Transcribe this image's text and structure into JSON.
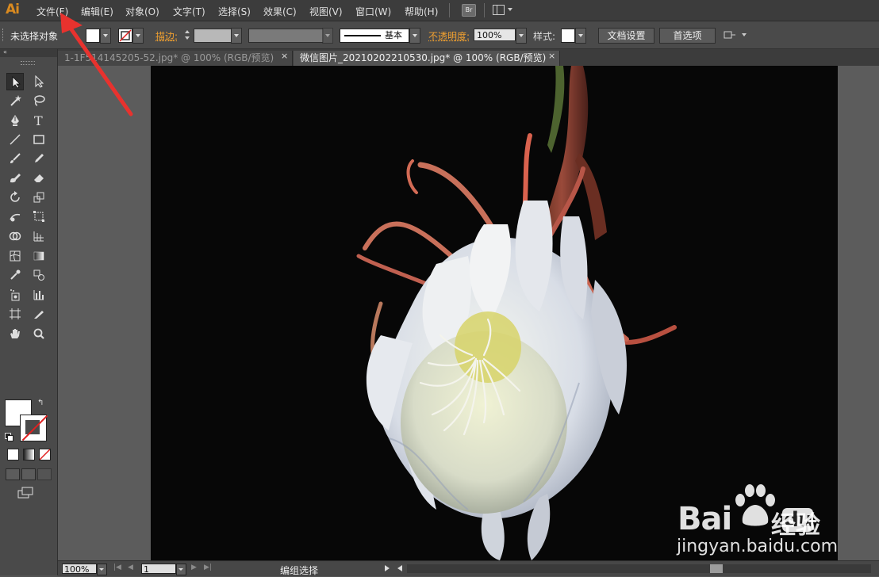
{
  "app": {
    "logo": "Ai"
  },
  "menu": {
    "items": [
      "文件(F)",
      "编辑(E)",
      "对象(O)",
      "文字(T)",
      "选择(S)",
      "效果(C)",
      "视图(V)",
      "窗口(W)",
      "帮助(H)"
    ],
    "bridge_label": "Br"
  },
  "control_bar": {
    "selection_status": "未选择对象",
    "stroke_label": "描边:",
    "brush_label": "基本",
    "opacity_label": "不透明度:",
    "opacity_value": "100%",
    "style_label": "样式:",
    "document_setup": "文档设置",
    "preferences": "首选项"
  },
  "tabs": [
    {
      "title": "1-1F514145205-52.jpg* @ 100% (RGB/预览)",
      "close": "×"
    },
    {
      "title": "微信图片_20210202210530.jpg* @ 100% (RGB/预览)",
      "close": "×"
    }
  ],
  "status_bar": {
    "zoom": "100%",
    "artboard": "1",
    "status": "编组选择"
  },
  "watermark": {
    "brand": "Bai",
    "brand_du": "du",
    "brand_cn": "经验",
    "url": "jingyan.baidu.com"
  },
  "colors": {
    "accent_orange": "#f0a030",
    "annotation_arrow": "#e8322e",
    "canvas_bg": "#070707"
  }
}
